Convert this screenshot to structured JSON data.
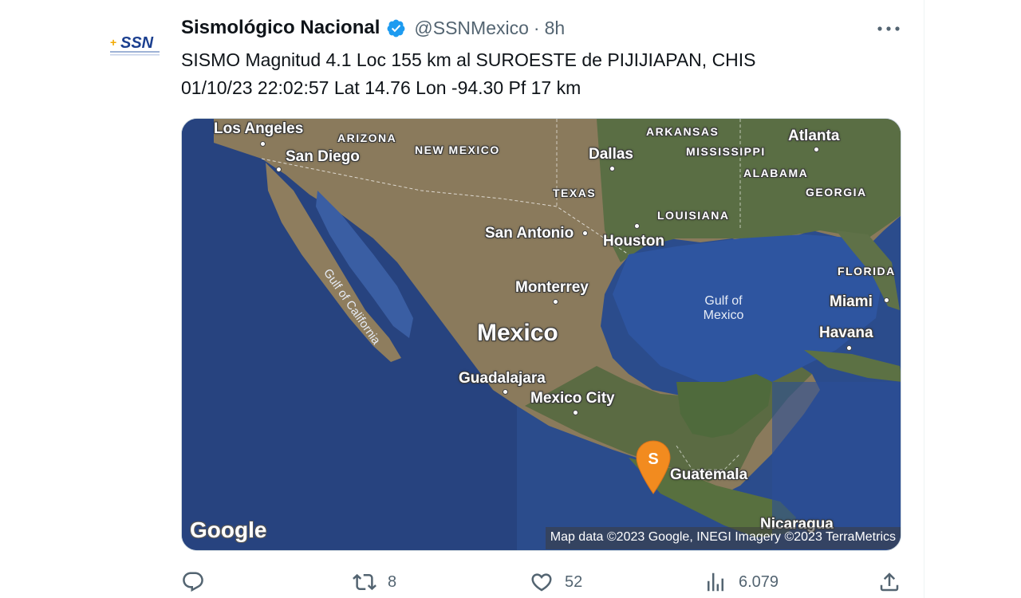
{
  "tweet": {
    "author_name": "Sismológico Nacional",
    "handle": "@SSNMexico",
    "separator": "·",
    "time": "8h",
    "avatar_text": "SSN",
    "text": "SISMO Magnitud 4.1 Loc  155 km al SUROESTE de PIJIJIAPAN, CHIS\n01/10/23 22:02:57 Lat 14.76 Lon -94.30 Pf 17 km"
  },
  "map": {
    "labels": {
      "los_angeles": "Los Angeles",
      "san_diego": "San Diego",
      "arizona": "ARIZONA",
      "new_mexico": "NEW MEXICO",
      "arkansas": "ARKANSAS",
      "atlanta": "Atlanta",
      "mississippi": "MISSISSIPPI",
      "dallas": "Dallas",
      "alabama": "ALABAMA",
      "texas": "TEXAS",
      "georgia": "GEORGIA",
      "louisiana": "LOUISIANA",
      "san_antonio": "San Antonio",
      "houston": "Houston",
      "gulf_california": "Gulf of California",
      "florida": "FLORIDA",
      "monterrey": "Monterrey",
      "gulf_mexico_1": "Gulf of",
      "gulf_mexico_2": "Mexico",
      "miami": "Miami",
      "mexico": "Mexico",
      "havana": "Havana",
      "guadalajara": "Guadalajara",
      "mexico_city": "Mexico City",
      "guatemala": "Guatemala",
      "nicaragua": "Nicaragua"
    },
    "pin_letter": "S",
    "google_logo": "Google",
    "attribution": "Map data ©2023 Google, INEGI Imagery ©2023 TerraMetrics"
  },
  "actions": {
    "reply_count": "",
    "retweet_count": "8",
    "like_count": "52",
    "views_count": "6.079"
  },
  "colors": {
    "verified": "#1d9bf0",
    "pin": "#f28b1f",
    "secondary_text": "#536471"
  },
  "icons": [
    "more-icon",
    "verified-icon",
    "reply-icon",
    "retweet-icon",
    "like-icon",
    "views-icon",
    "share-icon",
    "map-pin-icon"
  ]
}
